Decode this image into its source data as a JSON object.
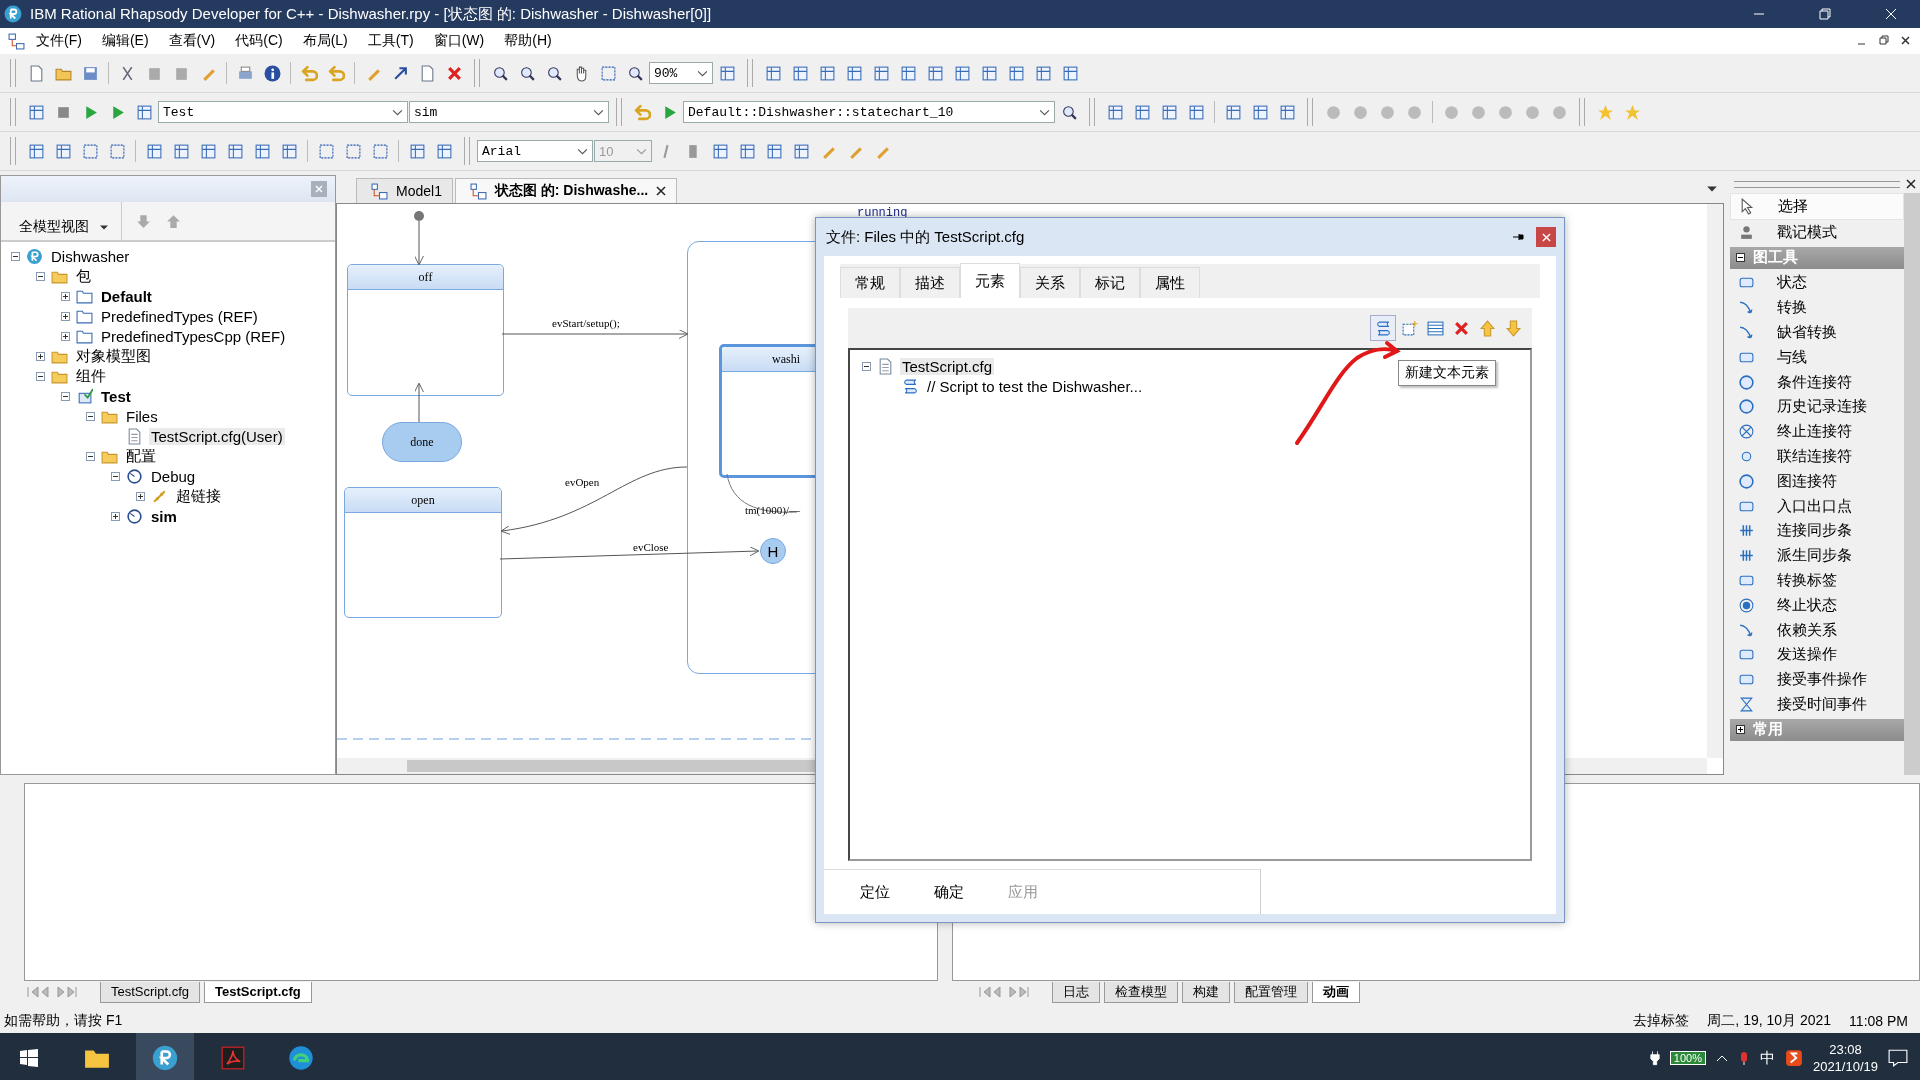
{
  "window": {
    "title": "IBM Rational Rhapsody Developer for C++ - Dishwasher.rpy - [状态图 的:  Dishwasher - Dishwasher[0]]"
  },
  "menu": [
    "文件(F)",
    "编辑(E)",
    "查看(V)",
    "代码(C)",
    "布局(L)",
    "工具(T)",
    "窗口(W)",
    "帮助(H)"
  ],
  "toolbar": {
    "zoom_combo": "90%",
    "config_combo": "Test",
    "build_combo": "sim",
    "path_combo": "Default::Dishwasher::statechart_10",
    "font_combo": "Arial",
    "size_combo": "10"
  },
  "browser": {
    "view_combo": "全模型视图",
    "tree": [
      {
        "label": "Dishwasher",
        "kind": "project",
        "active": false,
        "selected": false,
        "expanded": true,
        "children": [
          {
            "label": "包",
            "kind": "folder",
            "active": false,
            "selected": false,
            "expanded": true,
            "children": [
              {
                "label": "Default",
                "kind": "package",
                "active": true,
                "selected": false,
                "expanded": false
              },
              {
                "label": "PredefinedTypes (REF)",
                "kind": "package",
                "active": false,
                "selected": false,
                "expanded": false
              },
              {
                "label": "PredefinedTypesCpp (REF)",
                "kind": "package",
                "active": false,
                "selected": false,
                "expanded": false
              }
            ]
          },
          {
            "label": "对象模型图",
            "kind": "folder",
            "active": false,
            "selected": false,
            "expanded": false
          },
          {
            "label": "组件",
            "kind": "folder",
            "active": false,
            "selected": false,
            "expanded": true,
            "children": [
              {
                "label": "Test",
                "kind": "component",
                "active": true,
                "selected": false,
                "expanded": true,
                "children": [
                  {
                    "label": "Files",
                    "kind": "folder",
                    "active": false,
                    "selected": false,
                    "expanded": true,
                    "children": [
                      {
                        "label": "TestScript.cfg(User)",
                        "kind": "file",
                        "active": false,
                        "selected": true
                      }
                    ]
                  },
                  {
                    "label": "配置",
                    "kind": "folder",
                    "active": false,
                    "selected": false,
                    "expanded": true,
                    "children": [
                      {
                        "label": "Debug",
                        "kind": "config",
                        "active": false,
                        "selected": false,
                        "expanded": true,
                        "children": [
                          {
                            "label": "超链接",
                            "kind": "hyperlink",
                            "active": false,
                            "selected": false,
                            "expanded": false
                          }
                        ]
                      },
                      {
                        "label": "sim",
                        "kind": "config",
                        "active": true,
                        "selected": false,
                        "expanded": false
                      }
                    ]
                  }
                ]
              }
            ]
          }
        ]
      }
    ]
  },
  "editor": {
    "tabs": [
      {
        "label": "Model1",
        "selected": false
      },
      {
        "label": "状态图 的:  Dishwashe...",
        "selected": true
      }
    ],
    "diagram": {
      "states": [
        {
          "name": "off"
        },
        {
          "name": "done"
        },
        {
          "name": "open"
        },
        {
          "name": "washi"
        }
      ],
      "superstate_label": "running",
      "transitions": [
        "evStart/setup();",
        "evOpen",
        "evClose",
        "tm(1000)/—"
      ],
      "history_label": "H"
    }
  },
  "dialog": {
    "title": "文件:  Files 中的 TestScript.cfg",
    "tabs": [
      {
        "label": "常规",
        "selected": false
      },
      {
        "label": "描述",
        "selected": false
      },
      {
        "label": "元素",
        "selected": true
      },
      {
        "label": "关系",
        "selected": false
      },
      {
        "label": "标记",
        "selected": false
      },
      {
        "label": "属性",
        "selected": false
      }
    ],
    "tooltip": "新建文本元素",
    "tree": [
      {
        "label": "TestScript.cfg",
        "expanded": true,
        "children": [
          {
            "label": "// Script to test the Dishwasher..."
          }
        ]
      }
    ],
    "buttons": [
      {
        "label": "定位",
        "disabled": false
      },
      {
        "label": "确定",
        "disabled": false
      },
      {
        "label": "应用",
        "disabled": true
      }
    ]
  },
  "palette": {
    "top_items": [
      {
        "label": "选择",
        "selected": true
      },
      {
        "label": "戳记模式",
        "selected": false
      }
    ],
    "sections": [
      {
        "title": "图工具",
        "expanded": true,
        "items": [
          "状态",
          "转换",
          "缺省转换",
          "与线",
          "条件连接符",
          "历史记录连接",
          "终止连接符",
          "联结连接符",
          "图连接符",
          "入口出口点",
          "连接同步条",
          "派生同步条",
          "转换标签",
          "终止状态",
          "依赖关系",
          "发送操作",
          "接受事件操作",
          "接受时间事件"
        ]
      },
      {
        "title": "常用",
        "expanded": false
      }
    ]
  },
  "output": {
    "left_tabs": [
      {
        "label": "TestScript.cfg",
        "selected": false
      },
      {
        "label": "TestScript.cfg",
        "selected": true
      }
    ],
    "right_tabs": [
      {
        "label": "日志",
        "selected": false
      },
      {
        "label": "检查模型",
        "selected": false
      },
      {
        "label": "构建",
        "selected": false
      },
      {
        "label": "配置管理",
        "selected": false
      },
      {
        "label": "动画",
        "selected": true
      }
    ]
  },
  "status_bar": {
    "help": "如需帮助，请按 F1",
    "mode": "去掉标签",
    "date": "周二, 19, 10月 2021",
    "time": "11:08 PM"
  },
  "taskbar": {
    "battery": "100%",
    "ime": "中",
    "clock_time": "23:08",
    "clock_date": "2021/10/19"
  }
}
